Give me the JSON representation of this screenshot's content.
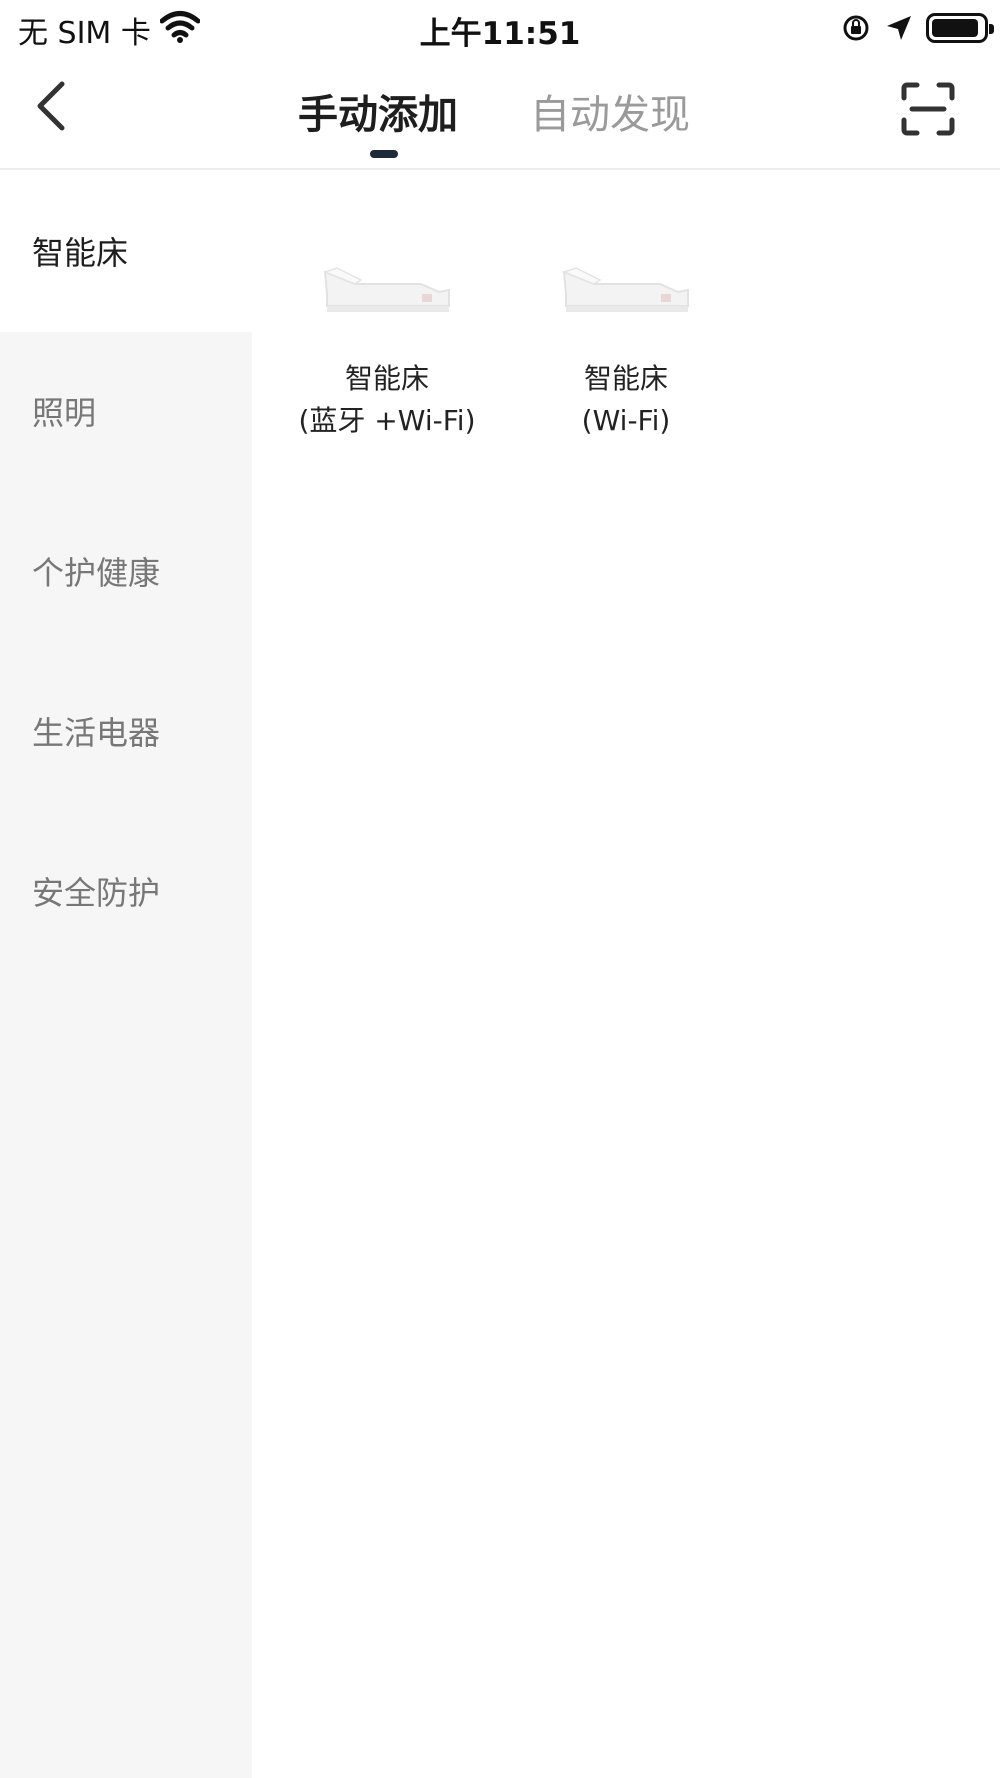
{
  "status_bar": {
    "carrier": "无 SIM 卡",
    "time": "上午11:51"
  },
  "nav": {
    "tabs": [
      {
        "label": "手动添加",
        "active": true
      },
      {
        "label": "自动发现",
        "active": false
      }
    ],
    "icons": [
      "back-icon",
      "scan-icon"
    ]
  },
  "sidebar": {
    "items": [
      {
        "label": "智能床",
        "active": true
      },
      {
        "label": "照明",
        "active": false
      },
      {
        "label": "个护健康",
        "active": false
      },
      {
        "label": "生活电器",
        "active": false
      },
      {
        "label": "安全防护",
        "active": false
      }
    ]
  },
  "devices": [
    {
      "name": "智能床",
      "sub": "(蓝牙 +Wi-Fi)",
      "icon": "adjustable-bed-icon"
    },
    {
      "name": "智能床",
      "sub": "(Wi-Fi)",
      "icon": "adjustable-bed-icon"
    }
  ],
  "colors": {
    "accent_indicator": "#1f2a3c",
    "sidebar_bg": "#f6f6f6",
    "inactive_text": "#777777"
  }
}
